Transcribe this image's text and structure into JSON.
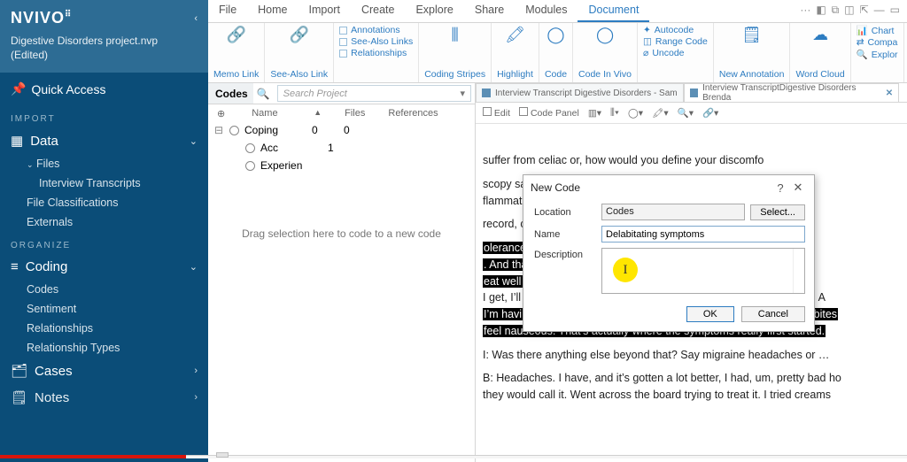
{
  "sidebar": {
    "logo": "NVIVO",
    "logo_mark": "⠿",
    "project_line1": "Digestive Disorders project.nvp",
    "project_line2": "(Edited)",
    "quick_access": "Quick Access",
    "sections": {
      "import": {
        "heading": "IMPORT",
        "data": "Data",
        "files": "Files",
        "interview": "Interview Transcripts",
        "fileclass": "File Classifications",
        "externals": "Externals"
      },
      "organize": {
        "heading": "ORGANIZE",
        "coding": "Coding",
        "codes": "Codes",
        "sentiment": "Sentiment",
        "relationships": "Relationships",
        "reltypes": "Relationship Types",
        "cases": "Cases",
        "notes": "Notes"
      }
    }
  },
  "menubar": {
    "items": [
      "File",
      "Home",
      "Import",
      "Create",
      "Explore",
      "Share",
      "Modules",
      "Document"
    ],
    "active_index": 7
  },
  "ribbon": {
    "memo": "Memo\nLink",
    "seealso": "See-Also\nLink",
    "annotations": "Annotations",
    "seealsolinks": "See-Also Links",
    "relationships": "Relationships",
    "coding_stripes": "Coding\nStripes",
    "highlight": "Highlight",
    "code": "Code",
    "codeinvivo": "Code\nIn Vivo",
    "autocode": "Autocode",
    "rangecode": "Range Code",
    "uncode": "Uncode",
    "newanno": "New\nAnnotation",
    "wordcloud": "Word\nCloud",
    "chart": "Chart",
    "compare": "Compa",
    "explore": "Explor"
  },
  "codes_pane": {
    "title": "Codes",
    "search_ph": "Search Project",
    "cols": {
      "name": "Name",
      "files": "Files",
      "refs": "References"
    },
    "rows": [
      {
        "exp": "⊟",
        "name": "Coping",
        "files": "0",
        "refs": "0"
      },
      {
        "exp": "",
        "name": "Acc",
        "files": "1",
        "refs": ""
      },
      {
        "exp": "",
        "name": "Experien",
        "files": "",
        "refs": ""
      }
    ],
    "drop_hint": "Drag selection here to code to a new code"
  },
  "doc_pane": {
    "tabs": [
      {
        "label": "Interview Transcript Digestive Disorders - Sam",
        "active": false,
        "closable": false
      },
      {
        "label": "Interview TranscriptDigestive Disorders Brenda",
        "active": true,
        "closable": true
      }
    ],
    "tools": {
      "edit": "Edit",
      "panel": "Code Panel"
    },
    "p1": " suffer from celiac or, how would you define your discomfo",
    "p2a": "scopy says no celiac and not inflammatory bowel disease. N",
    "p2b": "flammatory bowel disease. I would label myself definitely g",
    "p3": " record, can you describe what that means? Gluten intoleran",
    "hl1": "olerance means that you, your body just does not digest or b",
    "hl2": ". And that is a protein that is found in wheat. I would also sa",
    "hl3": "eat well either. Um, and the symptoms are across the board.",
    "hl_after3": "I get, I’ll get joint pains, exhaustion, um, and I just feel incredibly full. A",
    "hl4": "I’m having, say, pasta or something where it’s just, after four or five bites",
    "hl5": " feel nauseous. That’s actually where the symptoms really first started.",
    "p_i": "I: Was there anything else beyond that?  Say migraine headaches or …",
    "p_b": "B: Headaches. I have, and it’s gotten a lot better, I had, um, pretty bad ho",
    "p_b2": "they would call it. Went across the board trying to treat it. I tried creams"
  },
  "dialog": {
    "title": "New Code",
    "location_label": "Location",
    "location_value": "Codes",
    "select": "Select...",
    "name_label": "Name",
    "name_value": "Delabitating symptoms",
    "desc_label": "Description",
    "ok": "OK",
    "cancel": "Cancel",
    "help": "?",
    "close": "✕"
  }
}
